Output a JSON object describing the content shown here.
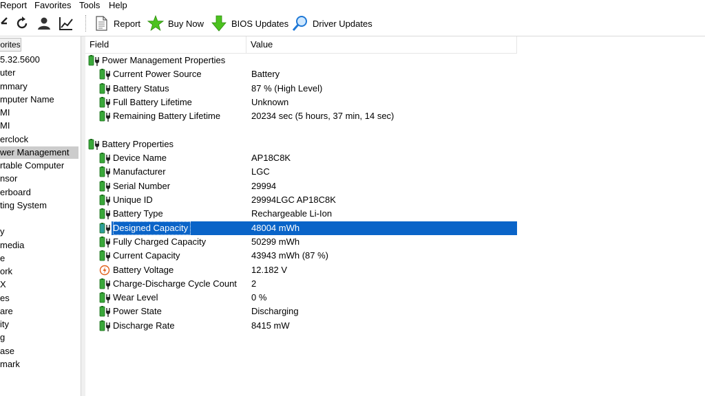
{
  "menu": [
    "Report",
    "Favorites",
    "Tools",
    "Help"
  ],
  "toolbar": {
    "report": "Report",
    "buy_now": "Buy Now",
    "bios_updates": "BIOS Updates",
    "driver_updates": "Driver Updates"
  },
  "left": {
    "tab": "orites",
    "items": [
      "5.32.5600",
      "uter",
      "mmary",
      "mputer Name",
      "MI",
      "MI",
      "erclock",
      "wer Management",
      "rtable Computer",
      "nsor",
      "erboard",
      "ting System",
      "",
      "y",
      "media",
      "e",
      "ork",
      "X",
      "es",
      "are",
      "ity",
      "g",
      "ase",
      "mark"
    ],
    "selected_index": 7
  },
  "columns": {
    "field": "Field",
    "value": "Value"
  },
  "groups": [
    {
      "title": "Power Management Properties",
      "rows": [
        {
          "field": "Current Power Source",
          "value": "Battery",
          "icon": "battery-plug-icon"
        },
        {
          "field": "Battery Status",
          "value": "87 % (High Level)",
          "icon": "battery-plug-icon"
        },
        {
          "field": "Full Battery Lifetime",
          "value": "Unknown",
          "icon": "battery-plug-icon"
        },
        {
          "field": "Remaining Battery Lifetime",
          "value": "20234 sec (5 hours, 37 min, 14 sec)",
          "icon": "battery-plug-icon"
        }
      ]
    },
    {
      "title": "Battery Properties",
      "rows": [
        {
          "field": "Device Name",
          "value": "AP18C8K",
          "icon": "battery-plug-icon"
        },
        {
          "field": "Manufacturer",
          "value": "LGC",
          "icon": "battery-plug-icon"
        },
        {
          "field": "Serial Number",
          "value": "29994",
          "icon": "battery-plug-icon"
        },
        {
          "field": "Unique ID",
          "value": "29994LGC AP18C8K",
          "icon": "battery-plug-icon"
        },
        {
          "field": "Battery Type",
          "value": "Rechargeable Li-Ion",
          "icon": "battery-plug-icon"
        },
        {
          "field": "Designed Capacity",
          "value": "48004 mWh",
          "icon": "battery-plug-icon",
          "selected": true
        },
        {
          "field": "Fully Charged Capacity",
          "value": "50299 mWh",
          "icon": "battery-plug-icon"
        },
        {
          "field": "Current Capacity",
          "value": "43943 mWh  (87 %)",
          "icon": "battery-plug-icon"
        },
        {
          "field": "Battery Voltage",
          "value": "12.182 V",
          "icon": "voltage-icon"
        },
        {
          "field": "Charge-Discharge Cycle Count",
          "value": "2",
          "icon": "battery-plug-icon"
        },
        {
          "field": "Wear Level",
          "value": "0 %",
          "icon": "battery-plug-icon"
        },
        {
          "field": "Power State",
          "value": "Discharging",
          "icon": "battery-plug-icon"
        },
        {
          "field": "Discharge Rate",
          "value": "8415 mW",
          "icon": "battery-plug-icon"
        }
      ]
    }
  ],
  "colors": {
    "selection": "#0a64c8",
    "battery_green": "#3aa83a",
    "left_selection": "#cccccc"
  }
}
